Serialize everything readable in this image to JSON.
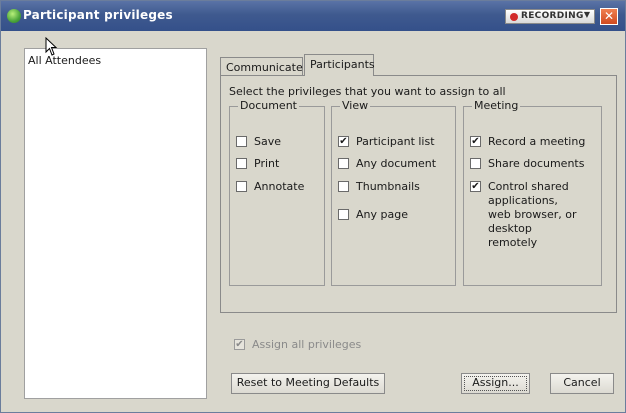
{
  "window": {
    "title": "Participant privileges",
    "recording_label": "RECORDING",
    "close_symbol": "✕"
  },
  "left_panel": {
    "items": [
      "All Attendees"
    ]
  },
  "tabs": [
    {
      "label": "Communicate",
      "active": false
    },
    {
      "label": "Participants",
      "active": true
    }
  ],
  "panel": {
    "instruction": "Select the privileges that you want to assign to all",
    "groups": [
      {
        "title": "Document",
        "options": [
          {
            "label": "Save",
            "checked": false
          },
          {
            "label": "Print",
            "checked": false
          },
          {
            "label": "Annotate",
            "checked": false
          }
        ]
      },
      {
        "title": "View",
        "options": [
          {
            "label": "Participant list",
            "checked": true
          },
          {
            "label": "Any document",
            "checked": false
          },
          {
            "label": "Thumbnails",
            "checked": false
          },
          {
            "label": "Any page",
            "checked": false
          }
        ]
      },
      {
        "title": "Meeting",
        "options": [
          {
            "label": "Record a meeting",
            "checked": true
          },
          {
            "label": "Share documents",
            "checked": false
          },
          {
            "label": "Control shared applications, web browser, or desktop remotely",
            "checked": true
          }
        ]
      }
    ]
  },
  "assign_all": {
    "label": "Assign all privileges",
    "checked": true,
    "disabled": true
  },
  "buttons": {
    "reset": "Reset to Meeting Defaults",
    "assign": "Assign...",
    "cancel": "Cancel"
  },
  "colors": {
    "titlebar": "#3f5a8f",
    "dialog_bg": "#d9d7cc",
    "recording_dot": "#d22a2a",
    "close": "#d04a20"
  },
  "icons": {
    "app": "green-globe-icon",
    "cursor": "mouse-pointer-icon",
    "checkmark": "✔"
  }
}
